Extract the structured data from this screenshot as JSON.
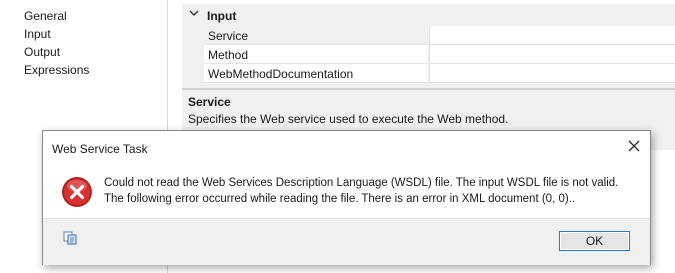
{
  "nav": {
    "items": [
      {
        "label": "General"
      },
      {
        "label": "Input"
      },
      {
        "label": "Output"
      },
      {
        "label": "Expressions"
      }
    ]
  },
  "property_grid": {
    "category": "Input",
    "rows": [
      {
        "name": "Service",
        "value": ""
      },
      {
        "name": "Method",
        "value": ""
      },
      {
        "name": "WebMethodDocumentation",
        "value": ""
      }
    ]
  },
  "description": {
    "title": "Service",
    "text": "Specifies the Web service used to execute the Web method."
  },
  "dialog": {
    "title": "Web Service Task",
    "message": "Could not read the Web Services Description Language (WSDL) file. The input WSDL file is not valid. The following error occurred while reading the file. There is an error in XML document (0, 0)..",
    "ok_label": "OK",
    "icons": {
      "status": "error-icon",
      "copy": "copy-icon",
      "close": "close-icon"
    }
  },
  "colors": {
    "error_red": "#d9302f",
    "button_border": "#2b79c6",
    "panel_gray": "#f0f0f0"
  }
}
